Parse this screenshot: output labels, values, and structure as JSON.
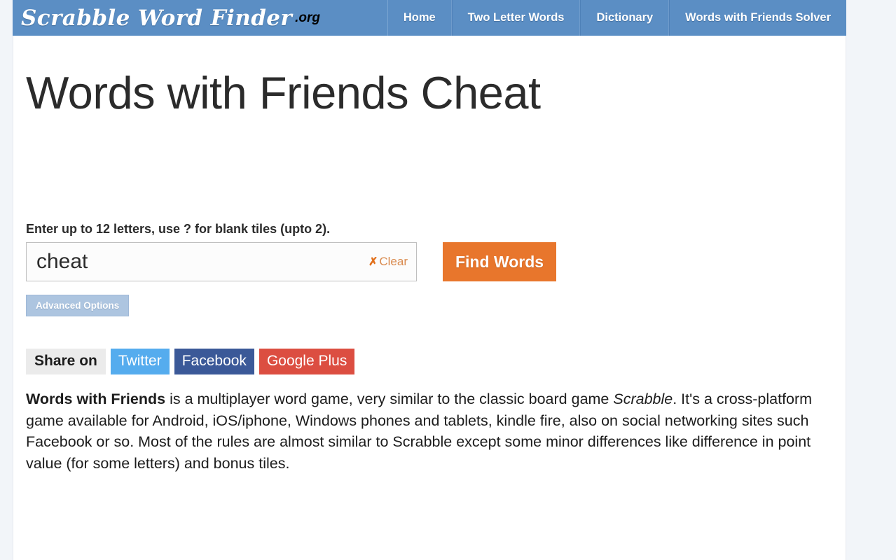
{
  "header": {
    "logo_text": "Scrabble Word Finder",
    "logo_tld": ".org",
    "nav": [
      {
        "label": "Home"
      },
      {
        "label": "Two Letter Words"
      },
      {
        "label": "Dictionary"
      },
      {
        "label": "Words with Friends Solver"
      }
    ],
    "bar_color": "#5b8ec4"
  },
  "main": {
    "title": "Words with Friends Cheat",
    "search": {
      "label": "Enter up to 12 letters, use ? for blank tiles (upto 2).",
      "value": "cheat",
      "placeholder": "",
      "clear_icon": "✗",
      "clear_label": "Clear",
      "clear_color": "#d98a4e",
      "submit_label": "Find Words",
      "submit_color": "#e8762c",
      "advanced_label": "Advanced Options",
      "advanced_color": "#adc5e0"
    },
    "share": {
      "label": "Share on",
      "buttons": [
        {
          "label": "Twitter",
          "color": "#55acee"
        },
        {
          "label": "Facebook",
          "color": "#3b5998"
        },
        {
          "label": "Google Plus",
          "color": "#dc4e41"
        }
      ]
    },
    "intro": {
      "lead": "Words with Friends",
      "part1": " is a multiplayer word game, very similar to the classic board game ",
      "emphasis": "Scrabble",
      "part2": ". It's a cross-platform game available for Android, iOS/iphone, Windows phones and tablets, kindle fire, also on social networking sites such Facebook or so. Most of the rules are almost similar to Scrabble except some minor differences like difference in point value (for some letters) and bonus tiles."
    }
  }
}
